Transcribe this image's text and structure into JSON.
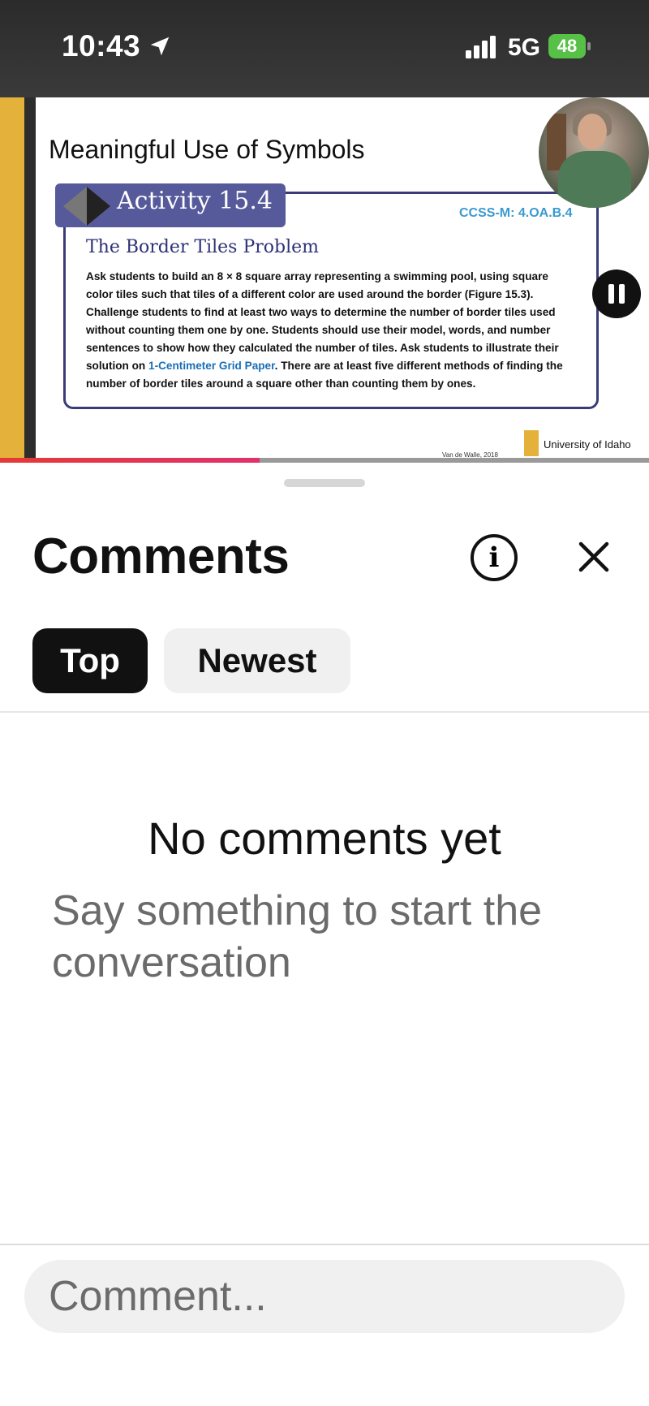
{
  "status": {
    "time": "10:43",
    "network": "5G",
    "battery": "48"
  },
  "slide": {
    "title": "Meaningful Use of Symbols",
    "activity": "Activity 15.4",
    "standard": "CCSS-M: 4.OA.B.4",
    "problem_title": "The Border Tiles Problem",
    "body_part1": "Ask students to build an 8 × 8 square array representing a swimming pool, using square color tiles such that tiles of a different color are used around the border (Figure 15.3). Challenge students to find at least two ways to determine the number of border tiles used without counting them one by one. Students should use their model, words, and number sentences to show how they calculated the number of tiles. Ask students to illustrate their solution on ",
    "body_link": "1-Centimeter Grid Paper",
    "body_part2": ". There are at least five different methods of finding the number of border tiles around a square other than counting them by ones.",
    "logo_text": "University of Idaho",
    "citation": "Van de Walle, 2018"
  },
  "video": {
    "progress": 0.4
  },
  "comments": {
    "title": "Comments",
    "tabs": [
      {
        "label": "Top",
        "selected": true
      },
      {
        "label": "Newest",
        "selected": false
      }
    ],
    "empty_title": "No comments yet",
    "empty_subtitle": "Say something to start the conversation",
    "input_placeholder": "Comment..."
  },
  "icons": [
    "location-arrow-icon",
    "signal-icon",
    "battery-icon",
    "pause-icon",
    "info-icon",
    "close-icon"
  ]
}
